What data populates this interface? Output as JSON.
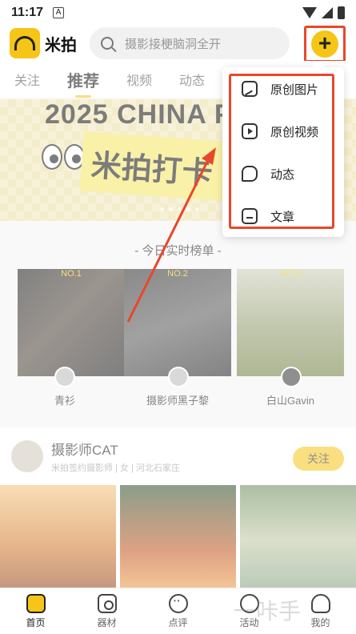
{
  "status_bar": {
    "time": "11:17",
    "notif_glyph": "A"
  },
  "header": {
    "app_name": "米拍",
    "search_placeholder": "摄影接梗脑洞全开",
    "add_label": "+"
  },
  "tabs": [
    "关注",
    "推荐",
    "视频",
    "动态"
  ],
  "banner": {
    "title": "2025 CHINA P",
    "main_text": "米拍打卡"
  },
  "ranking": {
    "title": "- 今日实时榜单 -",
    "items": [
      {
        "no": "NO.1",
        "name": "青衫"
      },
      {
        "no": "NO.2",
        "name": "摄影师黑子黎"
      },
      {
        "no": "NO.3",
        "name": "白山Gavin"
      }
    ]
  },
  "photographer": {
    "name": "摄影师CAT",
    "subtitle": "米拍签约摄影师 | 女 | 河北石家庄",
    "follow_label": "关注"
  },
  "popup_menu": [
    {
      "label": "原创图片",
      "icon": "image-icon"
    },
    {
      "label": "原创视频",
      "icon": "video-icon"
    },
    {
      "label": "动态",
      "icon": "chat-bubble-icon"
    },
    {
      "label": "文章",
      "icon": "document-icon"
    }
  ],
  "bottom_nav": [
    "首页",
    "器材",
    "点评",
    "活动",
    "我的"
  ],
  "watermark": "一咔手",
  "colors": {
    "accent": "#f5c518",
    "highlight": "#e8472a"
  }
}
